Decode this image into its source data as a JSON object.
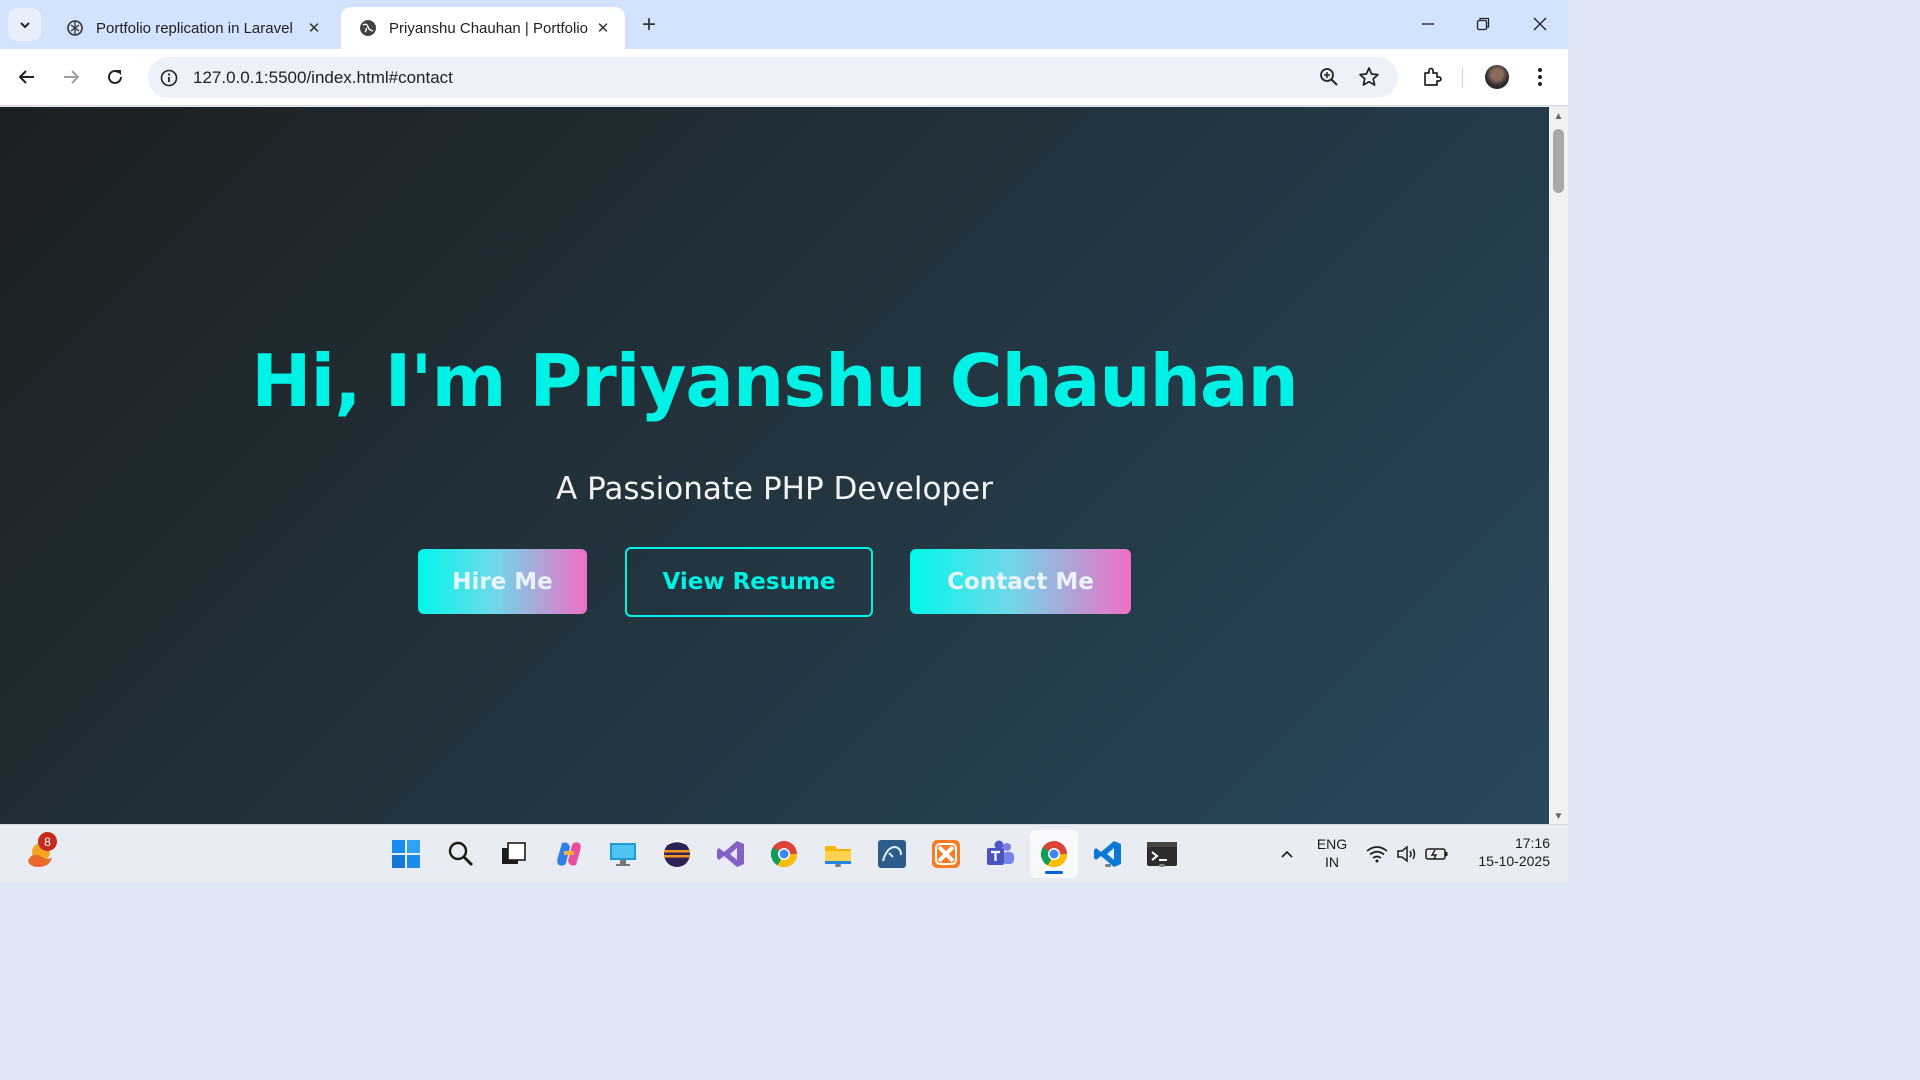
{
  "browser": {
    "tabs": [
      {
        "title": "Portfolio replication in Laravel",
        "favicon": "openai-icon",
        "active": false
      },
      {
        "title": "Priyanshu Chauhan | Portfolio",
        "favicon": "globe-icon",
        "active": true
      }
    ],
    "url": "127.0.0.1:5500/index.html#contact"
  },
  "page": {
    "title": "Hi, I'm Priyanshu Chauhan",
    "subtitle": "A Passionate PHP Developer",
    "buttons": {
      "hire": "Hire Me",
      "resume": "View Resume",
      "contact": "Contact Me"
    },
    "colors": {
      "accent": "#00f2e6",
      "gradient_start": "#00f7ea",
      "gradient_end": "#ef6ec6",
      "background_dark": "#1b2022",
      "background_light": "#27495c"
    }
  },
  "taskbar": {
    "notification_count": "8",
    "apps": [
      "start-icon",
      "search-icon",
      "task-view-icon",
      "copilot-icon",
      "remote-desktop-icon",
      "eclipse-icon",
      "visual-studio-icon",
      "chrome-icon",
      "file-explorer-icon",
      "mysql-workbench-icon",
      "xampp-icon",
      "teams-icon",
      "chrome-active-icon",
      "vscode-icon",
      "terminal-icon"
    ],
    "language_line1": "ENG",
    "language_line2": "IN",
    "time": "17:16",
    "date": "15-10-2025"
  }
}
